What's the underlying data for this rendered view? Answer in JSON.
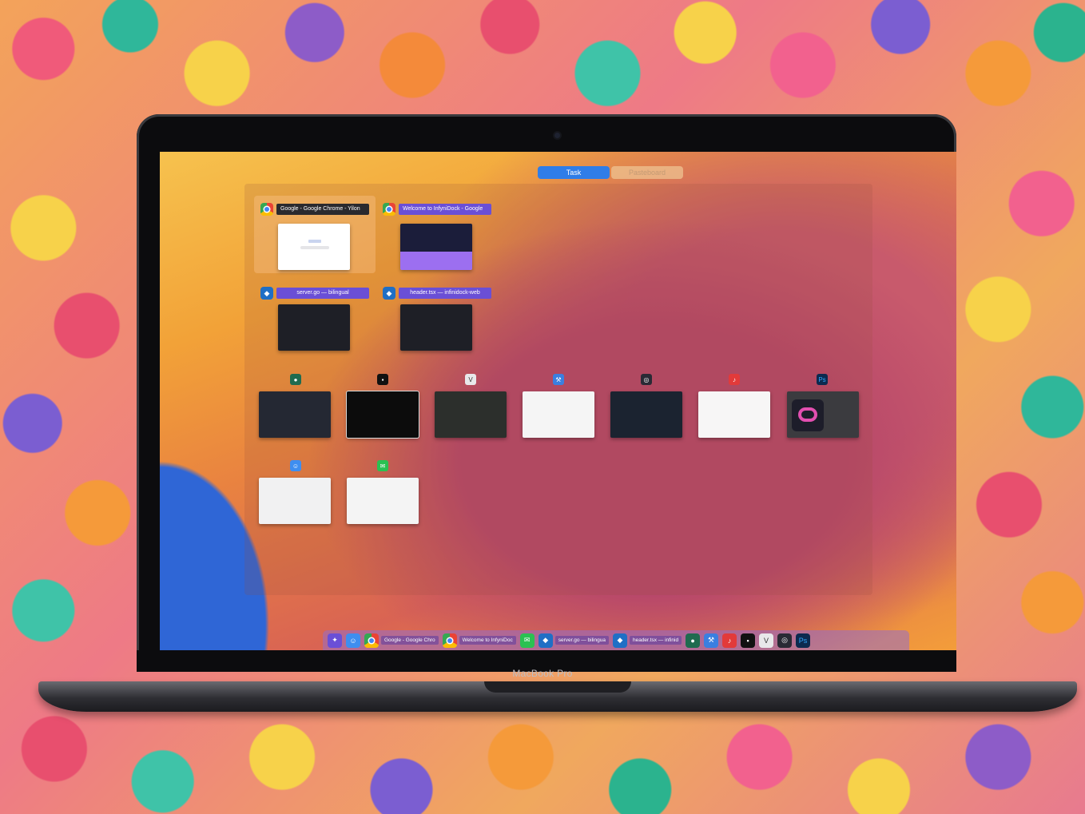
{
  "laptop": {
    "brand": "MacBook Pro"
  },
  "segments": {
    "task": "Task",
    "pasteboard": "Pasteboard"
  },
  "windows": [
    {
      "title": "Google - Google Chrome - Yilon"
    },
    {
      "title": "Welcome to InfyniDock - Google"
    },
    {
      "title": "server.go — bilingual"
    },
    {
      "title": "header.tsx — infinidock-web"
    }
  ],
  "dock": {
    "items": [
      {
        "label": "Google - Google Chro"
      },
      {
        "label": "Welcome to InfyniDoc"
      },
      {
        "label": "server.go — bilingua"
      },
      {
        "label": "header.tsx — infinid"
      }
    ]
  },
  "colors": {
    "accent": "#2f7de8",
    "title_bar": "#6a4fd6"
  }
}
